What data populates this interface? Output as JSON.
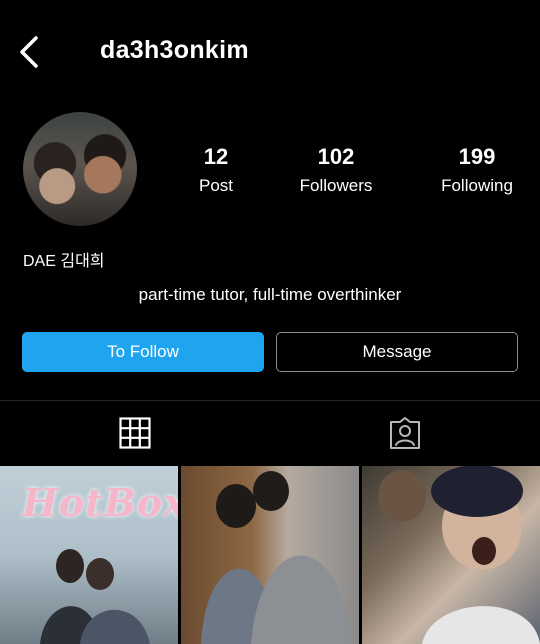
{
  "header": {
    "username": "da3h3onkim",
    "back_icon": "chevron-left-icon"
  },
  "stats": [
    {
      "value": "12",
      "label": "Post"
    },
    {
      "value": "102",
      "label": "Followers"
    },
    {
      "value": "199",
      "label": "Following"
    }
  ],
  "profile": {
    "display_name": "DAE 김대희",
    "bio": "part-time tutor, full-time overthinker"
  },
  "actions": {
    "follow_label": "To Follow",
    "message_label": "Message"
  },
  "tabs": [
    {
      "name": "grid",
      "icon": "grid-icon"
    },
    {
      "name": "tagged",
      "icon": "tagged-person-icon"
    }
  ],
  "photos": [
    {
      "overlay_text": "HotBox"
    },
    {
      "overlay_text": ""
    },
    {
      "overlay_text": ""
    }
  ],
  "colors": {
    "accent": "#20a4f0",
    "background": "#000000",
    "text": "#ffffff"
  }
}
